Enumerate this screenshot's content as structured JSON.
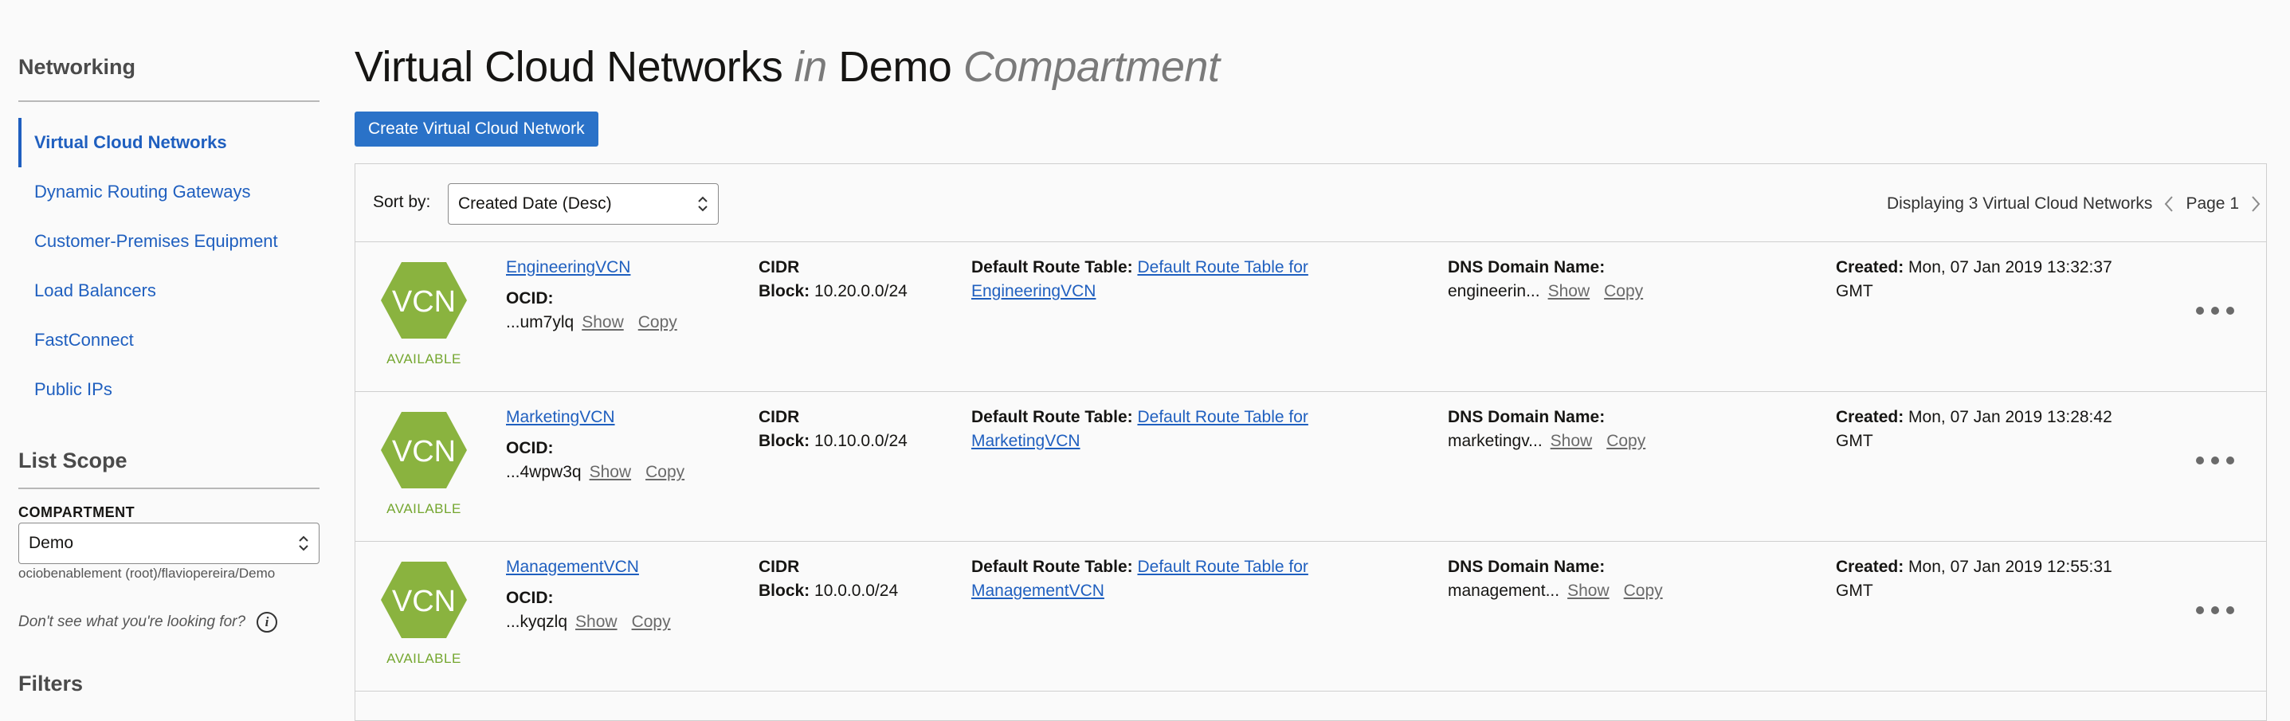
{
  "sidebar": {
    "title": "Networking",
    "nav": [
      {
        "label": "Virtual Cloud Networks"
      },
      {
        "label": "Dynamic Routing Gateways"
      },
      {
        "label": "Customer-Premises Equipment"
      },
      {
        "label": "Load Balancers"
      },
      {
        "label": "FastConnect"
      },
      {
        "label": "Public IPs"
      }
    ],
    "scope_title": "List Scope",
    "compartment_label": "COMPARTMENT",
    "compartment_value": "Demo",
    "compartment_path": "ociobenablement (root)/flaviopereira/Demo",
    "help_text": "Don't see what you're looking for?",
    "info_glyph": "i",
    "filters_title": "Filters"
  },
  "header": {
    "title_main": "Virtual Cloud Networks",
    "title_in": "in",
    "title_compartment": "Demo",
    "title_suffix": "Compartment",
    "create_button": "Create Virtual Cloud Network"
  },
  "toolbar": {
    "sort_label": "Sort by:",
    "sort_value": "Created Date (Desc)",
    "displaying": "Displaying 3 Virtual Cloud Networks",
    "page": "Page 1"
  },
  "labels": {
    "badge": "VCN",
    "ocid": "OCID:",
    "cidr": "CIDR",
    "block": "Block:",
    "route_table": "Default Route Table:",
    "dns": "DNS Domain Name:",
    "created": "Created:",
    "show": "Show",
    "copy": "Copy"
  },
  "vcns": [
    {
      "name": "EngineeringVCN",
      "status": "AVAILABLE",
      "ocid": "...um7ylq",
      "cidr_block": "10.20.0.0/24",
      "route_table_line1": "Default Route Table for",
      "route_table_line2": "EngineeringVCN",
      "dns": "engineerin...",
      "created_line1": "Mon, 07 Jan 2019 13:32:37",
      "created_line2": "GMT"
    },
    {
      "name": "MarketingVCN",
      "status": "AVAILABLE",
      "ocid": "...4wpw3q",
      "cidr_block": "10.10.0.0/24",
      "route_table_line1": "Default Route Table for",
      "route_table_line2": "MarketingVCN",
      "dns": "marketingv...",
      "created_line1": "Mon, 07 Jan 2019 13:28:42",
      "created_line2": "GMT"
    },
    {
      "name": "ManagementVCN",
      "status": "AVAILABLE",
      "ocid": "...kyqzlq",
      "cidr_block": "10.0.0.0/24",
      "route_table_line1": "Default Route Table for",
      "route_table_line2": "ManagementVCN",
      "dns": "management...",
      "created_line1": "Mon, 07 Jan 2019 12:55:31",
      "created_line2": "GMT"
    }
  ],
  "colors": {
    "accent": "#1f5fbf",
    "button": "#2a72c8",
    "vcn_badge": "#8ab33f",
    "available": "#74a62f"
  }
}
